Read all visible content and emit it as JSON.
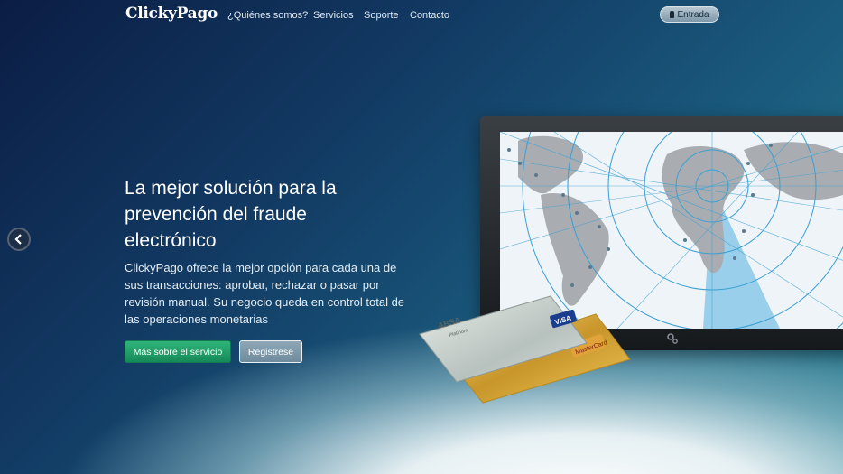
{
  "nav": {
    "brand": "ClickyPago",
    "links": [
      "¿Quiénes somos?",
      "Servicios",
      "Soporte",
      "Contacto"
    ],
    "login_label": "Entrada"
  },
  "hero": {
    "title": "La mejor solución para la prevención del fraude electrónico",
    "description": "ClickyPago ofrece la mejor opción para cada una de sus transacciones: aprobar, rechazar o pasar por revisión manual. Su negocio queda en control total de las operaciones monetarias",
    "primary_button": "Más sobre el servicio",
    "secondary_button": "Registrese"
  },
  "cards": {
    "bank_card_brand": "ABSA",
    "bank_card_sub": "Platinum",
    "visa_label": "VISA",
    "mastercard_label": "MasterCard"
  },
  "icons": {
    "prev": "chevron-left-icon",
    "next": "chevron-right-icon",
    "lock": "lock-icon",
    "gear": "gear-icon"
  },
  "colors": {
    "primary_button": "#1f9d6b",
    "background_dark": "#0b1d44",
    "background_teal": "#2a7f93"
  }
}
